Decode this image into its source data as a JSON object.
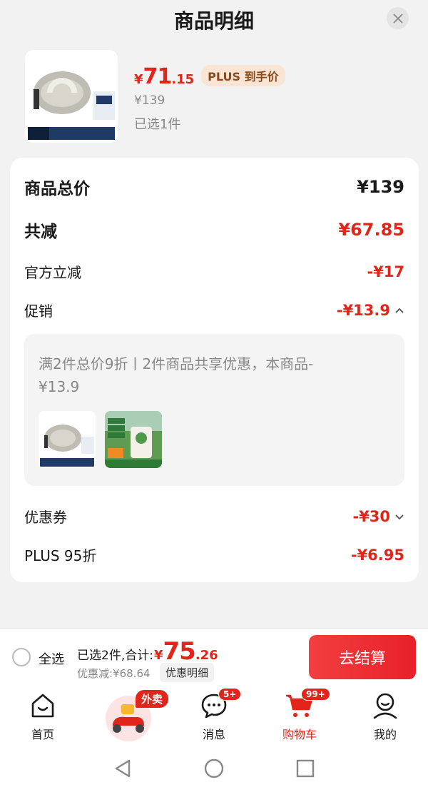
{
  "sheet": {
    "title": "商品明细"
  },
  "product": {
    "price_currency": "¥",
    "price_integer": "71",
    "price_decimal": ".15",
    "plus_tag": "PLUS 到手价",
    "original_price": "¥139",
    "selected_count": "已选1件"
  },
  "breakdown": {
    "total_label": "商品总价",
    "total_value": "¥139",
    "reduce_label": "共减",
    "reduce_value": "¥67.85",
    "official_label": "官方立减",
    "official_value": "-¥17",
    "promo_label": "促销",
    "promo_value": "-¥13.9",
    "promo_text": "满2件总价9折丨2件商品共享优惠，本商品-¥13.9",
    "coupon_label": "优惠券",
    "coupon_value": "-¥30",
    "plus_label": "PLUS 95折",
    "plus_value": "-¥6.95"
  },
  "bottom_bar": {
    "select_all": "全选",
    "total_prefix": "已选2件,合计:",
    "total_currency": "¥",
    "total_integer": "75",
    "total_decimal": ".26",
    "discount": "优惠减:¥68.64",
    "detail_button": "优惠明细",
    "checkout_button": "去结算"
  },
  "tabbar": {
    "home": "首页",
    "waimai_tag": "外卖",
    "messages": "消息",
    "messages_badge": "5+",
    "cart": "购物车",
    "cart_badge": "99+",
    "me": "我的"
  },
  "colors": {
    "accent": "#e1251b",
    "plus_tag_bg": "#fae4d3"
  },
  "icons": [
    "close-icon",
    "chevron-up-icon",
    "chevron-down-icon",
    "home-icon",
    "scooter-icon",
    "chat-icon",
    "cart-icon",
    "person-icon",
    "back-icon",
    "home-circle-icon",
    "recents-icon"
  ]
}
